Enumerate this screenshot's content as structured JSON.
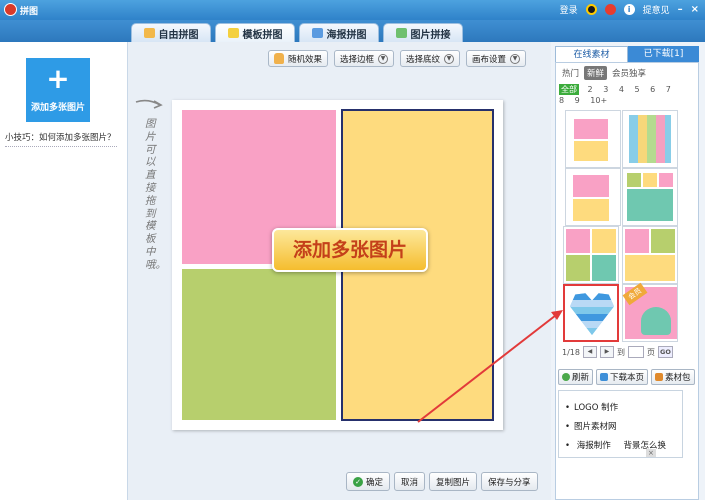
{
  "window": {
    "title": "拼图",
    "login_label": "登录",
    "feedback_label": "提意见"
  },
  "tabs": [
    {
      "label": "自由拼图"
    },
    {
      "label": "模板拼图"
    },
    {
      "label": "海报拼图"
    },
    {
      "label": "图片拼接"
    }
  ],
  "left_panel": {
    "add_plus": "+",
    "add_label": "添加多张图片",
    "tip": "小技巧：如何添加多张图片？"
  },
  "toolbar": {
    "random_label": "随机效果",
    "border_label": "选择边框",
    "texture_label": "选择底纹",
    "canvas_label": "画布设置"
  },
  "hint_text": "图片可以直接拖到模板中哦。",
  "callout_text": "添加多张图片",
  "bottom": {
    "ok_label": "确定",
    "cancel_label": "取消",
    "copy_label": "复制图片",
    "save_share_label": "保存与分享"
  },
  "right_panel": {
    "tab_online": "在线素材",
    "tab_downloaded": "已下载[1]",
    "categories": [
      "热门",
      "新鲜",
      "会员独享"
    ],
    "counts": [
      "全部",
      "2",
      "3",
      "4",
      "5",
      "6",
      "7",
      "8",
      "9",
      "10+"
    ],
    "vip_badge": "会员",
    "pager": {
      "page": "1/18",
      "to_label": "到",
      "page_label": "页",
      "go_label": "GO"
    },
    "actions": {
      "refresh": "刷新",
      "download_page": "下载本页",
      "pack": "素材包"
    },
    "links": [
      "LOGO 制作",
      "图片素材网",
      "海报制作",
      "背景怎么换"
    ]
  },
  "colors": {
    "pink": "#f9a1c5",
    "green": "#b7cf6d",
    "yellow": "#fedb7e",
    "accent_blue": "#2e9be6",
    "arrow_red": "#e23a3a"
  }
}
